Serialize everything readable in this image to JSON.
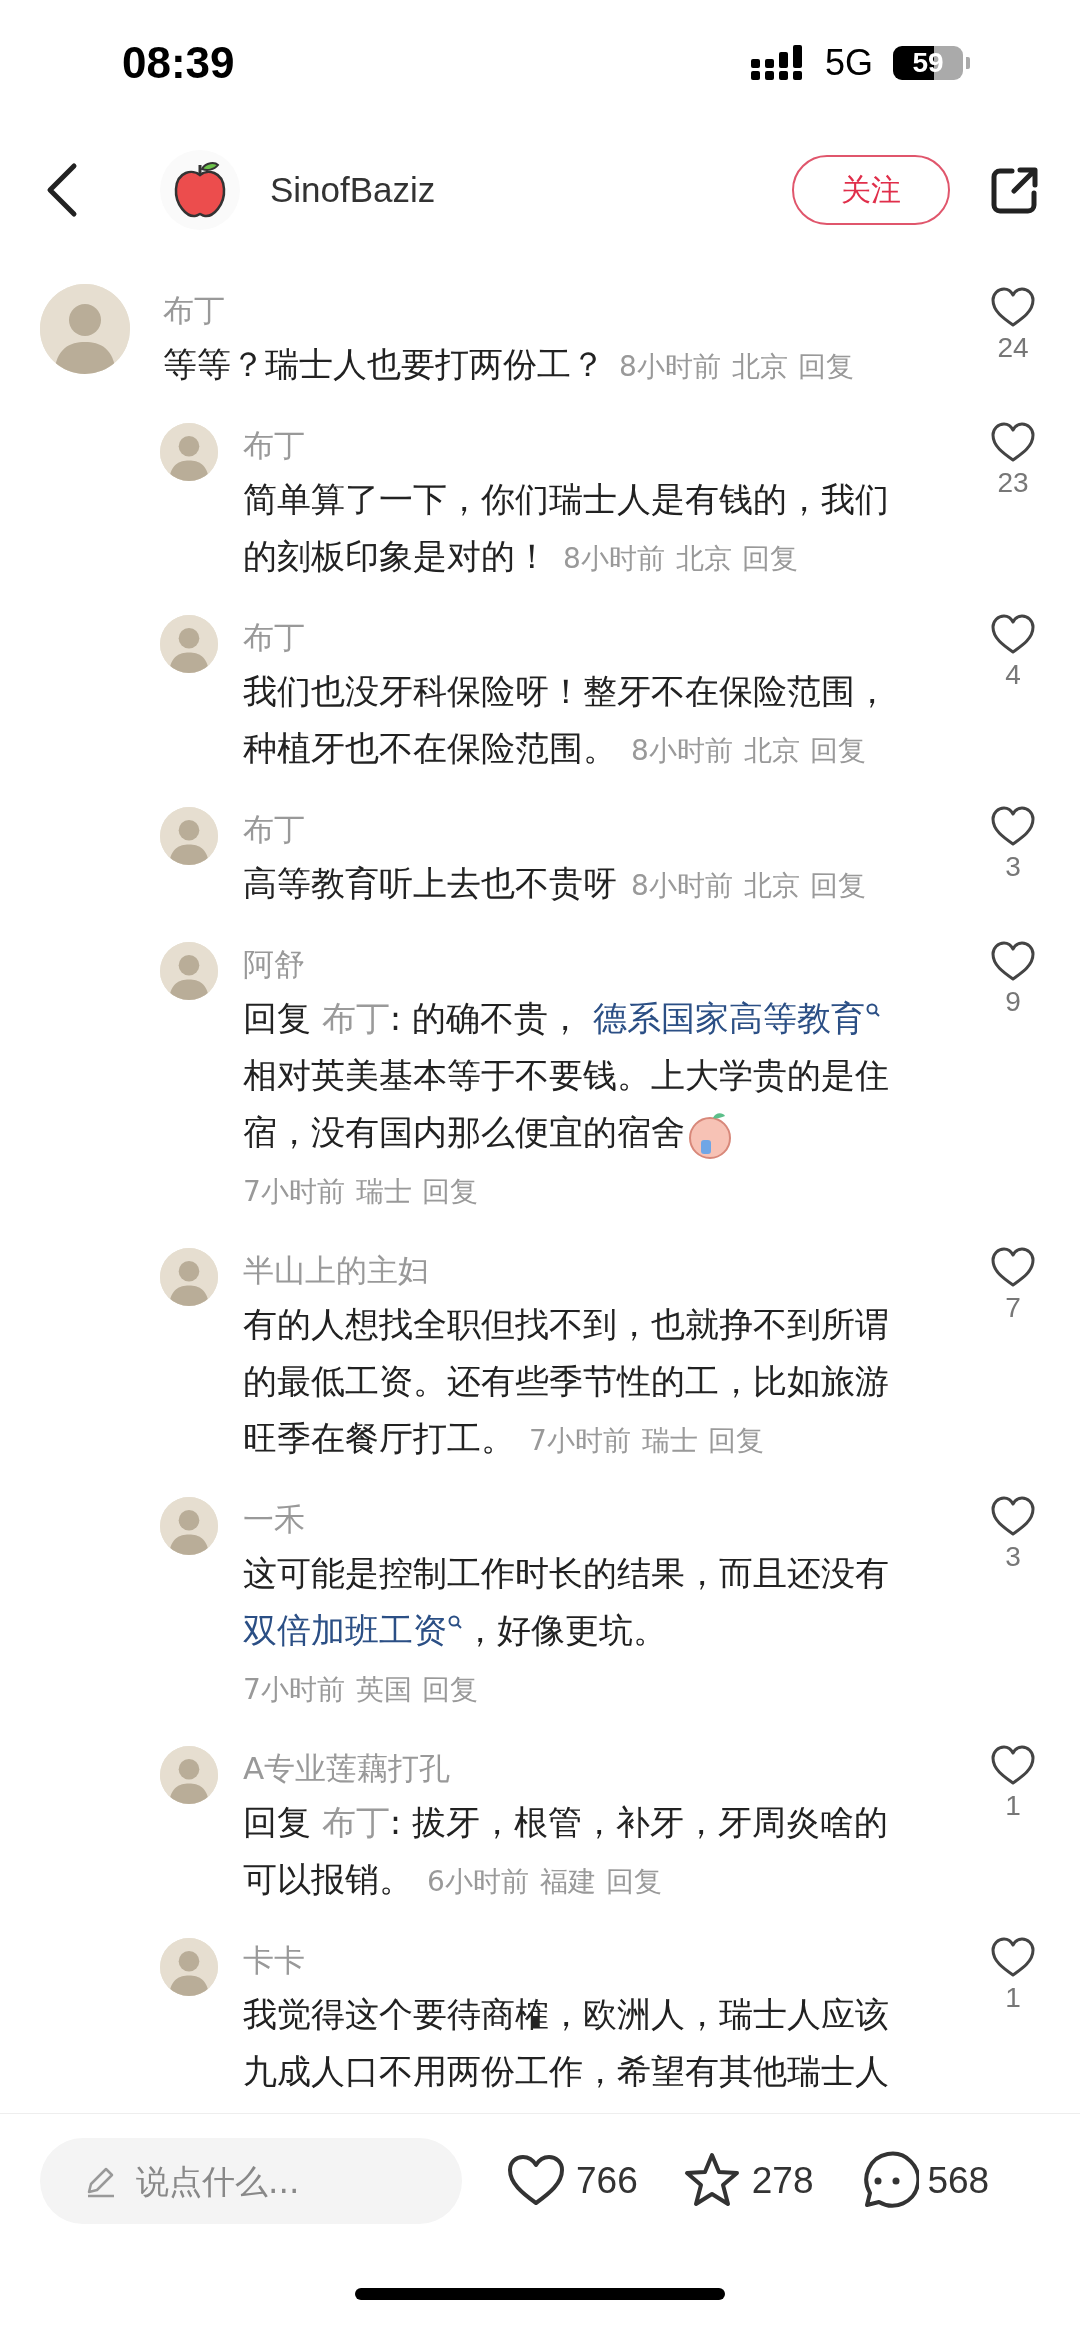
{
  "status_bar": {
    "time": "08:39",
    "network": "5G",
    "battery": "59"
  },
  "header": {
    "author": "SinofBaziz",
    "follow_button": "关注"
  },
  "comments": [
    {
      "kind": "top",
      "name": "布丁",
      "body": [
        {
          "kind": "text",
          "text": "等等？瑞士人也要打两份工？"
        }
      ],
      "meta_break": false,
      "time": "8小时前",
      "location": "北京",
      "reply": "回复",
      "likes": "24"
    },
    {
      "kind": "reply",
      "name": "布丁",
      "body": [
        {
          "kind": "text",
          "text": "简单算了一下，你们瑞士人是有钱的，我们的刻板印象是对的！"
        }
      ],
      "meta_break": false,
      "time": "8小时前",
      "location": "北京",
      "reply": "回复",
      "likes": "23"
    },
    {
      "kind": "reply",
      "name": "布丁",
      "body": [
        {
          "kind": "text",
          "text": "我们也没牙科保险呀！整牙不在保险范围，种植牙也不在保险范围。"
        }
      ],
      "meta_break": false,
      "time": "8小时前",
      "location": "北京",
      "reply": "回复",
      "likes": "4"
    },
    {
      "kind": "reply",
      "name": "布丁",
      "body": [
        {
          "kind": "text",
          "text": "高等教育听上去也不贵呀"
        }
      ],
      "meta_break": false,
      "time": "8小时前",
      "location": "北京",
      "reply": "回复",
      "likes": "3"
    },
    {
      "kind": "reply",
      "name": "阿舒",
      "body": [
        {
          "kind": "text",
          "text": "回复 "
        },
        {
          "kind": "mention",
          "text": "布丁"
        },
        {
          "kind": "text",
          "text": ": 的确不贵， "
        },
        {
          "kind": "link",
          "text": "德系国家高等教育"
        },
        {
          "kind": "text",
          "text": "相对英美基本等于不要钱。上大学贵的是住宿，没有国内那么便宜的宿舍"
        },
        {
          "kind": "sticker"
        }
      ],
      "meta_break": true,
      "time": "7小时前",
      "location": "瑞士",
      "reply": "回复",
      "likes": "9"
    },
    {
      "kind": "reply",
      "name": "半山上的主妇",
      "body": [
        {
          "kind": "text",
          "text": "有的人想找全职但找不到，也就挣不到所谓的最低工资。还有些季节性的工，比如旅游旺季在餐厅打工。"
        }
      ],
      "meta_break": false,
      "time": "7小时前",
      "location": "瑞士",
      "reply": "回复",
      "likes": "7"
    },
    {
      "kind": "reply",
      "name": "一禾",
      "body": [
        {
          "kind": "text",
          "text": "这可能是控制工作时长的结果，而且还没有"
        },
        {
          "kind": "link",
          "text": "双倍加班工资"
        },
        {
          "kind": "text",
          "text": "，好像更坑。"
        }
      ],
      "meta_break": true,
      "time": "7小时前",
      "location": "英国",
      "reply": "回复",
      "likes": "3"
    },
    {
      "kind": "reply",
      "name": "A专业莲藕打孔",
      "body": [
        {
          "kind": "text",
          "text": "回复 "
        },
        {
          "kind": "mention",
          "text": "布丁"
        },
        {
          "kind": "text",
          "text": ": 拔牙，根管，补牙，牙周炎啥的可以报销。"
        }
      ],
      "meta_break": false,
      "time": "6小时前",
      "location": "福建",
      "reply": "回复",
      "likes": "1"
    },
    {
      "kind": "reply",
      "name": "卡卡",
      "body": [
        {
          "kind": "text",
          "text": "我觉得这个要待商榷，欧洲人，瑞士人应该九成人口不用两份工作，希望有其他瑞士人"
        }
      ],
      "likes": "1"
    }
  ],
  "bottom_bar": {
    "placeholder": "说点什么...",
    "likes": "766",
    "favorites": "278",
    "comments": "568"
  }
}
